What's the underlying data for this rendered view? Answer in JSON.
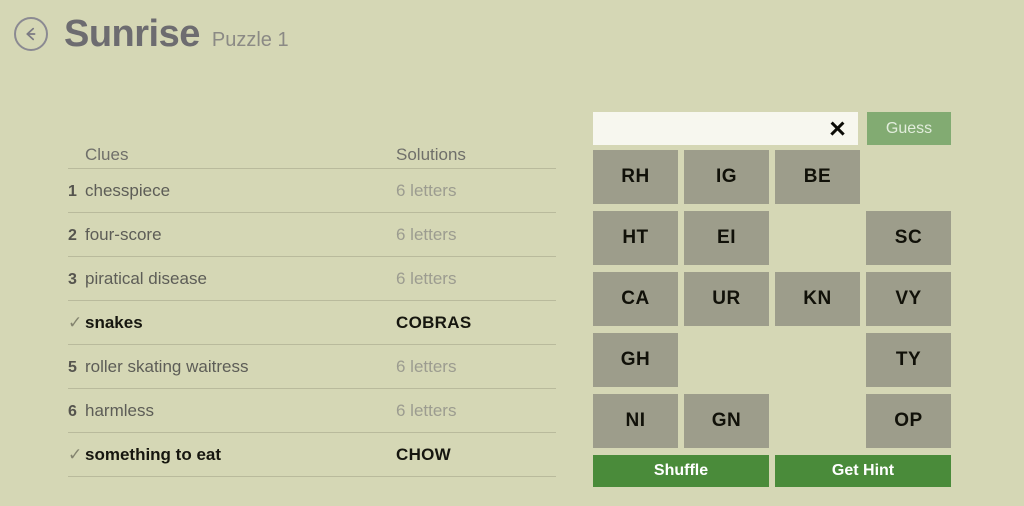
{
  "header": {
    "back_icon": "back-arrow-icon",
    "title": "Sunrise",
    "puzzle_label": "Puzzle 1"
  },
  "clue_table": {
    "columns": {
      "clues": "Clues",
      "solutions": "Solutions"
    },
    "rows": [
      {
        "marker": "1",
        "solved": false,
        "clue": "chesspiece",
        "answer": "6 letters"
      },
      {
        "marker": "2",
        "solved": false,
        "clue": "four-score",
        "answer": "6 letters"
      },
      {
        "marker": "3",
        "solved": false,
        "clue": "piratical disease",
        "answer": "6 letters"
      },
      {
        "marker": "✓",
        "solved": true,
        "clue": "snakes",
        "answer": "COBRAS"
      },
      {
        "marker": "5",
        "solved": false,
        "clue": "roller skating waitress",
        "answer": "6 letters"
      },
      {
        "marker": "6",
        "solved": false,
        "clue": "harmless",
        "answer": "6 letters"
      },
      {
        "marker": "✓",
        "solved": true,
        "clue": "something to eat",
        "answer": "CHOW"
      }
    ]
  },
  "play_panel": {
    "guess_input": {
      "value": "",
      "placeholder": ""
    },
    "clear_icon": "clear-x-icon",
    "guess_button": "Guess",
    "tiles": [
      {
        "label": "RH",
        "row": 0,
        "col": 0
      },
      {
        "label": "IG",
        "row": 0,
        "col": 1
      },
      {
        "label": "BE",
        "row": 0,
        "col": 2
      },
      {
        "label": "HT",
        "row": 1,
        "col": 0
      },
      {
        "label": "EI",
        "row": 1,
        "col": 1
      },
      {
        "label": "SC",
        "row": 1,
        "col": 3
      },
      {
        "label": "CA",
        "row": 2,
        "col": 0
      },
      {
        "label": "UR",
        "row": 2,
        "col": 1
      },
      {
        "label": "KN",
        "row": 2,
        "col": 2
      },
      {
        "label": "VY",
        "row": 2,
        "col": 3
      },
      {
        "label": "GH",
        "row": 3,
        "col": 0
      },
      {
        "label": "TY",
        "row": 3,
        "col": 3
      },
      {
        "label": "NI",
        "row": 4,
        "col": 0
      },
      {
        "label": "GN",
        "row": 4,
        "col": 1
      },
      {
        "label": "OP",
        "row": 4,
        "col": 3
      }
    ],
    "shuffle_button": "Shuffle",
    "hint_button": "Get Hint"
  },
  "colors": {
    "background": "#d5d7b5",
    "tile": "#9d9d8b",
    "action_green": "#4a8b3a",
    "guess_green_disabled": "#82ab72",
    "input_background": "#f7f7ef",
    "rule": "#b9ba9c"
  }
}
